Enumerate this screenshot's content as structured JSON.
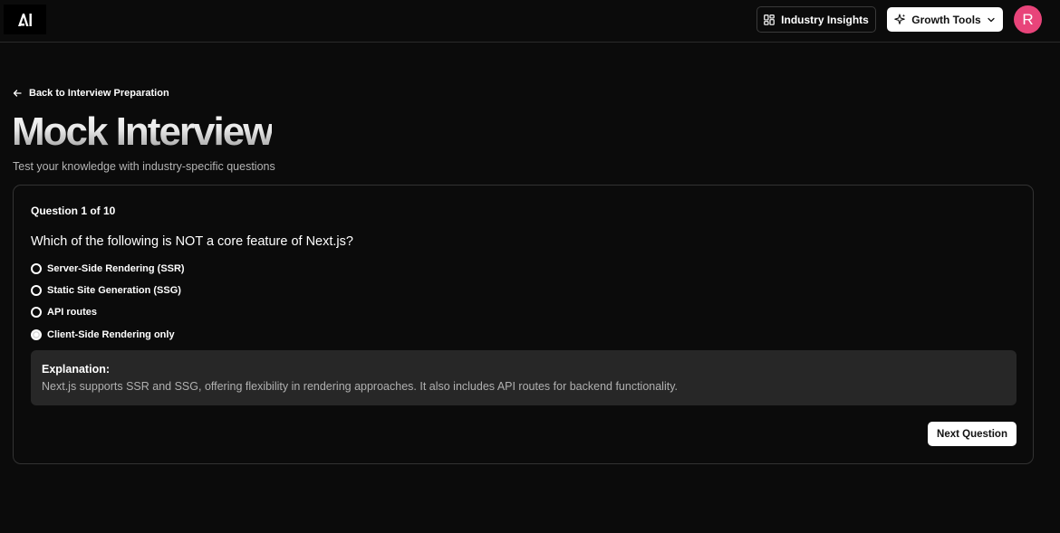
{
  "header": {
    "logo_text": "AI",
    "insights_label": "Industry Insights",
    "growth_label": "Growth Tools",
    "avatar_initial": "R"
  },
  "nav": {
    "back_label": "Back to Interview Preparation"
  },
  "page": {
    "title": "Mock Interview",
    "subtitle": "Test your knowledge with industry-specific questions"
  },
  "quiz": {
    "counter": "Question 1 of 10",
    "question": "Which of the following is NOT a core feature of Next.js?",
    "options": [
      {
        "label": "Server-Side Rendering (SSR)",
        "selected": false
      },
      {
        "label": "Static Site Generation (SSG)",
        "selected": false
      },
      {
        "label": "API routes",
        "selected": false
      },
      {
        "label": "Client-Side Rendering only",
        "selected": true
      }
    ],
    "explanation_title": "Explanation:",
    "explanation_text": "Next.js supports SSR and SSG, offering flexibility in rendering approaches. It also includes API routes for backend functionality.",
    "next_label": "Next Question"
  },
  "colors": {
    "background": "#0b0b0b",
    "avatar": "#e8447a",
    "explanation_bg": "#272727"
  },
  "icons": {
    "insights": "dashboard-grid-icon",
    "growth": "sparkles-icon",
    "dropdown": "chevron-down-icon",
    "back": "arrow-left-icon"
  }
}
